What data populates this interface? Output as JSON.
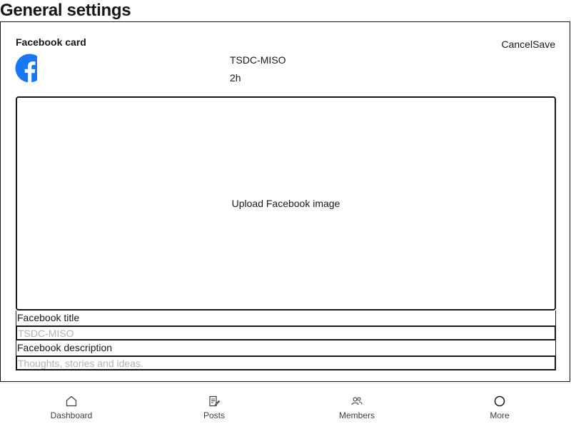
{
  "page": {
    "title": "General settings"
  },
  "card": {
    "title": "Facebook card",
    "cancel_label": "Cancel",
    "save_label": "Save",
    "account_name": "TSDC-MISO",
    "time_ago": "2h",
    "upload_label": "Upload Facebook image",
    "title_field": {
      "label": "Facebook title",
      "placeholder": "TSDC-MISO",
      "value": ""
    },
    "description_field": {
      "label": "Facebook description",
      "placeholder": "Thoughts, stories and ideas.",
      "value": ""
    },
    "brand_color": "#1877f2"
  },
  "nav": {
    "items": [
      {
        "label": "Dashboard",
        "icon": "home-icon"
      },
      {
        "label": "Posts",
        "icon": "posts-icon"
      },
      {
        "label": "Members",
        "icon": "members-icon"
      },
      {
        "label": "More",
        "icon": "more-icon"
      }
    ]
  }
}
